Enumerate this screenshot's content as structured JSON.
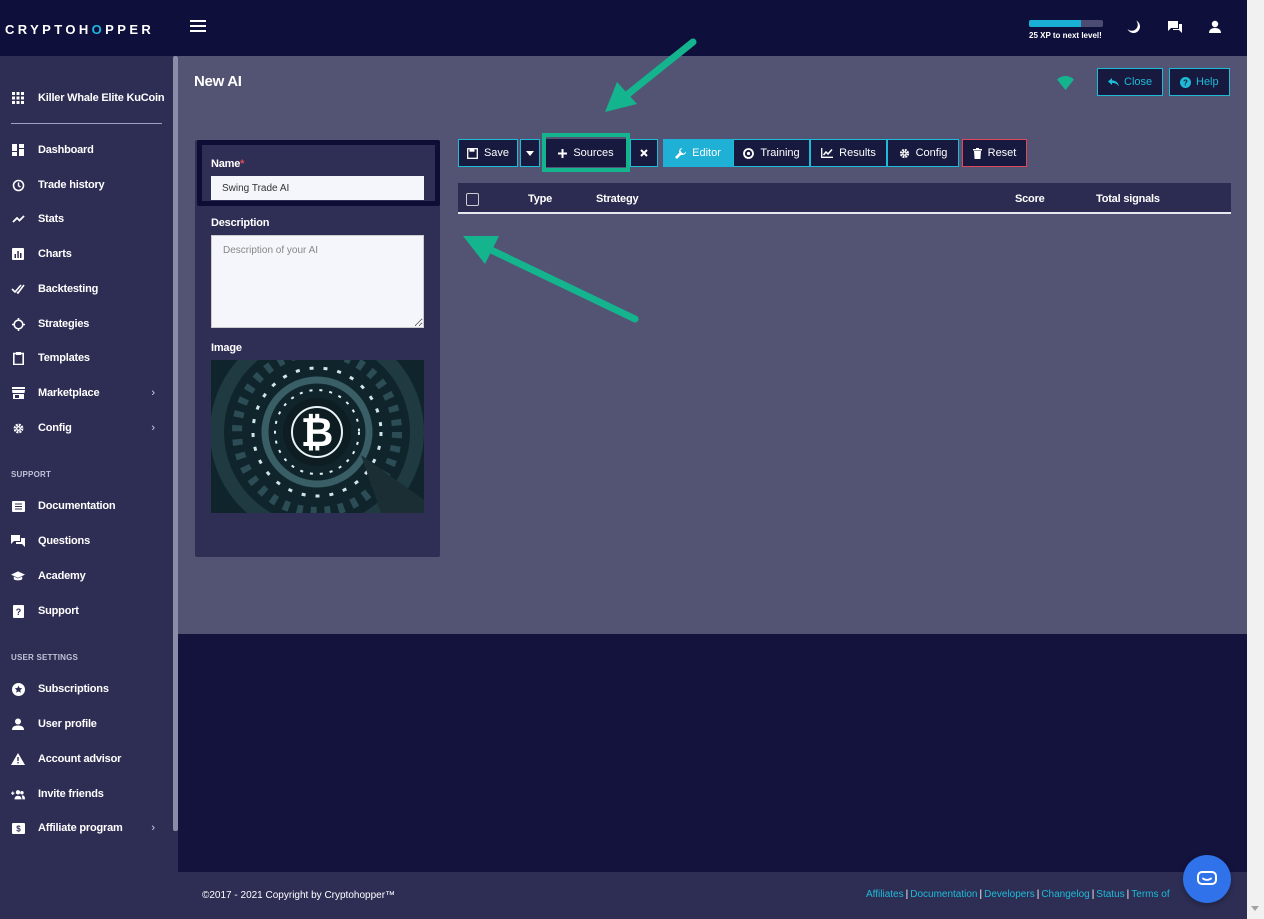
{
  "brand": {
    "logo_prefix": "CRYPTOH",
    "logo_o": "O",
    "logo_suffix": "PPER"
  },
  "header": {
    "xp_text": "25 XP to next level!",
    "xp_progress_percent": 70
  },
  "sidebar": {
    "hopper_name": "Killer Whale Elite KuCoin",
    "items": [
      {
        "label": "Dashboard",
        "icon": "dashboard-icon"
      },
      {
        "label": "Trade history",
        "icon": "history-icon"
      },
      {
        "label": "Stats",
        "icon": "trend-icon"
      },
      {
        "label": "Charts",
        "icon": "chart-icon"
      },
      {
        "label": "Backtesting",
        "icon": "double-check-icon"
      },
      {
        "label": "Strategies",
        "icon": "crosshair-icon"
      },
      {
        "label": "Templates",
        "icon": "clipboard-icon"
      },
      {
        "label": "Marketplace",
        "icon": "store-icon"
      },
      {
        "label": "Config",
        "icon": "gear-icon"
      }
    ],
    "support_heading": "SUPPORT",
    "support_items": [
      {
        "label": "Documentation",
        "icon": "book-icon"
      },
      {
        "label": "Questions",
        "icon": "chat-icon"
      },
      {
        "label": "Academy",
        "icon": "graduation-cap-icon"
      },
      {
        "label": "Support",
        "icon": "question-icon"
      }
    ],
    "user_heading": "USER SETTINGS",
    "user_items": [
      {
        "label": "Subscriptions",
        "icon": "star-icon"
      },
      {
        "label": "User profile",
        "icon": "user-icon"
      },
      {
        "label": "Account advisor",
        "icon": "warning-icon"
      },
      {
        "label": "Invite friends",
        "icon": "add-users-icon"
      },
      {
        "label": "Affiliate program",
        "icon": "dollar-icon"
      }
    ]
  },
  "page": {
    "title": "New AI",
    "close_label": "Close",
    "help_label": "Help"
  },
  "form": {
    "name_label": "Name",
    "name_required": "*",
    "name_value": "Swing Trade AI",
    "description_label": "Description",
    "description_placeholder": "Description of your AI",
    "image_label": "Image"
  },
  "toolbar": {
    "save_label": "Save",
    "sources_label": "Sources",
    "editor_label": "Editor",
    "training_label": "Training",
    "results_label": "Results",
    "config_label": "Config",
    "reset_label": "Reset"
  },
  "table": {
    "columns": [
      "Type",
      "Strategy",
      "Score",
      "Total signals"
    ]
  },
  "footer": {
    "copyright": "©2017 - 2021  Copyright by Cryptohopper™",
    "links": [
      "Affiliates",
      "Documentation",
      "Developers",
      "Changelog",
      "Status",
      "Terms of"
    ]
  },
  "colors": {
    "accent": "#1ebbd7",
    "highlight_green": "#13b48e",
    "danger": "#e0485a",
    "sidebar_bg": "#2e2e55",
    "main_bg": "#535473"
  }
}
